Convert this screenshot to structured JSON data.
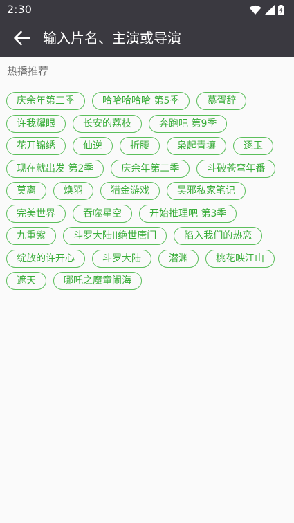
{
  "status_bar": {
    "time": "2:30",
    "icons": [
      "wifi-icon",
      "signal-icon",
      "battery-icon"
    ]
  },
  "app_bar": {
    "title": "输入片名、主演或导演",
    "back_icon": "arrow-left-icon"
  },
  "hot": {
    "title": "热播推荐",
    "tags": [
      "庆余年第三季",
      "哈哈哈哈哈 第5季",
      "慕胥辞",
      "许我耀眼",
      "长安的荔枝",
      "奔跑吧 第9季",
      "花开锦绣",
      "仙逆",
      "折腰",
      "枭起青壤",
      "逐玉",
      "现在就出发 第2季",
      "庆余年第二季",
      "斗破苍穹年番",
      "莫离",
      "焕羽",
      "猎金游戏",
      "吴邪私家笔记",
      "完美世界",
      "吞噬星空",
      "开始推理吧 第3季",
      "九重紫",
      "斗罗大陆II绝世唐门",
      "陷入我们的热恋",
      "绽放的许开心",
      "斗罗大陆",
      "潜渊",
      "桃花映江山",
      "遮天",
      "哪吒之魔童闹海"
    ]
  },
  "colors": {
    "bar_background": "#3a3940",
    "tag_border": "#5cbf5c",
    "tag_text": "#39ad39",
    "page_background": "#fafafa"
  }
}
